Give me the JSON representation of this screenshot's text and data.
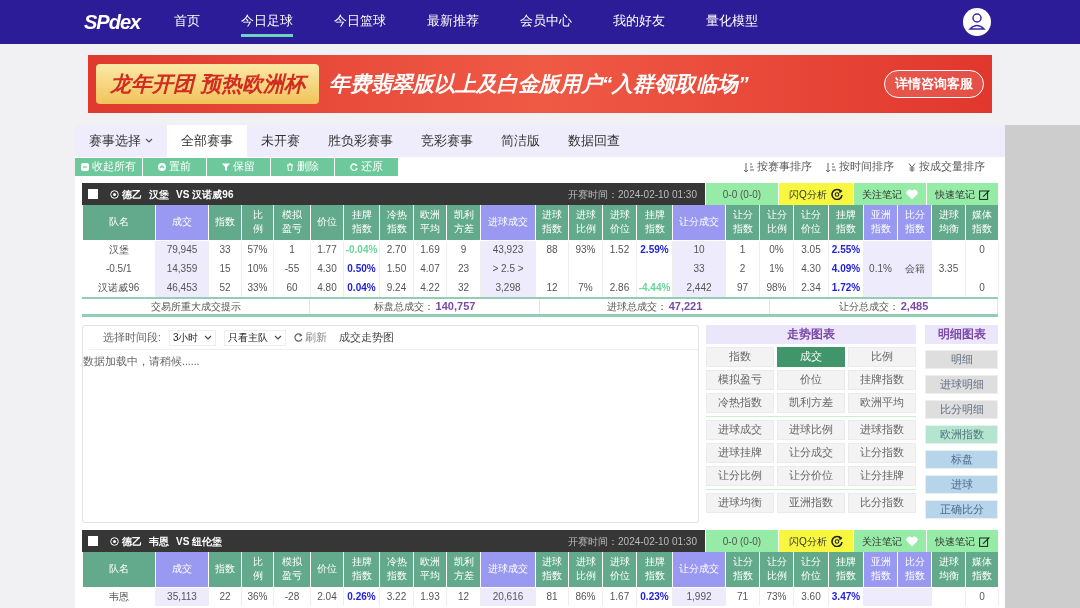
{
  "nav": {
    "logo": "SPdex",
    "items": [
      {
        "label": "首页",
        "selected": false
      },
      {
        "label": "今日足球",
        "selected": true
      },
      {
        "label": "今日篮球",
        "selected": false
      },
      {
        "label": "最新推荐",
        "selected": false
      },
      {
        "label": "会员中心",
        "selected": false
      },
      {
        "label": "我的好友",
        "selected": false
      },
      {
        "label": "量化模型",
        "selected": false
      }
    ]
  },
  "banner": {
    "headline": "龙年开团 预热欧洲杯",
    "message": "年费翡翠版以上及白金版用户“入群领取临场”",
    "button": "详情咨询客服"
  },
  "tabs": [
    {
      "label": "赛事选择",
      "kind": "dropdown",
      "selected": false
    },
    {
      "label": "全部赛事",
      "kind": "tab",
      "selected": true
    },
    {
      "label": "未开赛",
      "kind": "tab",
      "selected": false
    },
    {
      "label": "胜负彩赛事",
      "kind": "tab",
      "selected": false
    },
    {
      "label": "竞彩赛事",
      "kind": "tab",
      "selected": false
    },
    {
      "label": "简洁版",
      "kind": "tab",
      "selected": false
    },
    {
      "label": "数据回查",
      "kind": "tab",
      "selected": false
    }
  ],
  "toolbar": {
    "actions": [
      "收起所有",
      "置前",
      "保留",
      "删除",
      "还原"
    ],
    "sorts": [
      "按赛事排序",
      "按时间排序",
      "按成交量排序"
    ]
  },
  "matches": [
    {
      "checked": false,
      "league": "德乙",
      "home": "汉堡",
      "vs": "VS",
      "away": "汉诺威96",
      "kickoff_label": "开赛时间：",
      "kickoff": "2024-02-10 01:30",
      "score": "0-0 (0-0)",
      "analysis": "闪Q分析",
      "follow": "关注笔记",
      "note": "快速笔记",
      "columns": [
        {
          "label": "队名",
          "highlight": false
        },
        {
          "label": "成交",
          "highlight": true
        },
        {
          "label": "指数",
          "highlight": false
        },
        {
          "label": "比例",
          "highlight": false
        },
        {
          "label": "模拟盈亏",
          "highlight": false
        },
        {
          "label": "价位",
          "highlight": false
        },
        {
          "label": "挂牌指数",
          "highlight": false
        },
        {
          "label": "冷热指数",
          "highlight": false
        },
        {
          "label": "欧洲平均",
          "highlight": false
        },
        {
          "label": "凯利方差",
          "highlight": false
        },
        {
          "label": "进球成交",
          "highlight": true
        },
        {
          "label": "进球指数",
          "highlight": false
        },
        {
          "label": "进球比例",
          "highlight": false
        },
        {
          "label": "进球价位",
          "highlight": false
        },
        {
          "label": "挂牌指数",
          "highlight": false
        },
        {
          "label": "让分成交",
          "highlight": true
        },
        {
          "label": "让分指数",
          "highlight": false
        },
        {
          "label": "让分比例",
          "highlight": false
        },
        {
          "label": "让分价位",
          "highlight": false
        },
        {
          "label": "挂牌指数",
          "highlight": false
        },
        {
          "label": "亚洲指数",
          "highlight": true
        },
        {
          "label": "比分指数",
          "highlight": true
        },
        {
          "label": "进球均衡",
          "highlight": false
        },
        {
          "label": "媒体指数",
          "highlight": false
        }
      ],
      "rows": [
        [
          "汉堡",
          "79,945",
          "33",
          "57%",
          "1",
          "1.77",
          {
            "text": "-0.04%",
            "color": "#66d69a"
          },
          "2.70",
          "1.69",
          "9",
          "43,923",
          "88",
          "93%",
          "1.52",
          {
            "text": "2.59%",
            "color": "#2222dd"
          },
          "10",
          "1",
          "0%",
          "3.05",
          {
            "text": "2.55%",
            "color": "#2222dd"
          },
          null,
          null,
          null,
          "0"
        ],
        [
          "-0.5/1",
          "14,359",
          "15",
          "10%",
          "-55",
          "4.30",
          {
            "text": "0.50%",
            "color": "#2222dd"
          },
          "1.50",
          "4.07",
          "23",
          "> 2.5 >",
          null,
          null,
          null,
          null,
          "33",
          "2",
          "1%",
          "4.30",
          {
            "text": "4.09%",
            "color": "#2222dd"
          },
          "0.1%",
          "会籍",
          "3.35",
          null
        ],
        [
          "汉诺威96",
          "46,453",
          "52",
          "33%",
          "60",
          "4.80",
          {
            "text": "0.04%",
            "color": "#2222dd"
          },
          "9.24",
          "4.22",
          "32",
          "3,298",
          "12",
          "7%",
          "2.86",
          {
            "text": "-4.44%",
            "color": "#66d69a"
          },
          "2,442",
          "97",
          "98%",
          "2.34",
          {
            "text": "1.72%",
            "color": "#2222dd"
          },
          null,
          null,
          null,
          "0"
        ]
      ],
      "summary": [
        {
          "label": "交易所重大成交提示"
        },
        {
          "label": "标盘总成交：",
          "value": "140,757"
        },
        {
          "label": "进球总成交：",
          "value": "47,221"
        },
        {
          "label": "让分总成交：",
          "value": "2,485"
        }
      ],
      "chart_panel": {
        "range_label": "选择时间段:",
        "range": "3小时",
        "team_filter": "只看主队",
        "refresh": "刷新",
        "title": "成交走势图",
        "status": "数据加载中，请稍候......",
        "trend_title": "走势图表",
        "trend_groups": [
          [
            {
              "label": "指数",
              "selected": false
            },
            {
              "label": "成交",
              "selected": true
            },
            {
              "label": "比例",
              "selected": false
            },
            {
              "label": "模拟盈亏",
              "selected": false
            },
            {
              "label": "价位",
              "selected": false
            },
            {
              "label": "挂牌指数",
              "selected": false
            },
            {
              "label": "冷热指数",
              "selected": false
            },
            {
              "label": "凯利方差",
              "selected": false
            },
            {
              "label": "欧洲平均",
              "selected": false
            }
          ],
          [
            {
              "label": "进球成交",
              "selected": false
            },
            {
              "label": "进球比例",
              "selected": false
            },
            {
              "label": "进球指数",
              "selected": false
            },
            {
              "label": "进球挂牌",
              "selected": false
            },
            {
              "label": "让分成交",
              "selected": false
            },
            {
              "label": "让分指数",
              "selected": false
            },
            {
              "label": "让分比例",
              "selected": false
            },
            {
              "label": "让分价位",
              "selected": false
            },
            {
              "label": "让分挂牌",
              "selected": false
            }
          ],
          [
            {
              "label": "进球均衡",
              "selected": false
            },
            {
              "label": "亚洲指数",
              "selected": false
            },
            {
              "label": "比分指数",
              "selected": false
            }
          ]
        ],
        "detail_title": "明细图表",
        "details": [
          {
            "label": "明细",
            "color": "#dedede"
          },
          {
            "label": "进球明细",
            "color": "#dedede"
          },
          {
            "label": "比分明细",
            "color": "#dedede"
          },
          {
            "label": "欧洲指数",
            "color": "#b4e5cf"
          },
          {
            "label": "标盘",
            "color": "#b6d4ea"
          },
          {
            "label": "进球",
            "color": "#b6d4ea"
          },
          {
            "label": "正确比分",
            "color": "#b6d4ea"
          }
        ]
      }
    },
    {
      "checked": false,
      "league": "德乙",
      "home": "韦恩",
      "vs": "VS",
      "away": "纽伦堡",
      "kickoff_label": "开赛时间：",
      "kickoff": "2024-02-10 01:30",
      "score": "0-0 (0-0)",
      "analysis": "闪Q分析",
      "follow": "关注笔记",
      "note": "快速笔记",
      "columns": [
        {
          "label": "队名",
          "highlight": false
        },
        {
          "label": "成交",
          "highlight": true
        },
        {
          "label": "指数",
          "highlight": false
        },
        {
          "label": "比例",
          "highlight": false
        },
        {
          "label": "模拟盈亏",
          "highlight": false
        },
        {
          "label": "价位",
          "highlight": false
        },
        {
          "label": "挂牌指数",
          "highlight": false
        },
        {
          "label": "冷热指数",
          "highlight": false
        },
        {
          "label": "欧洲平均",
          "highlight": false
        },
        {
          "label": "凯利方差",
          "highlight": false
        },
        {
          "label": "进球成交",
          "highlight": true
        },
        {
          "label": "进球指数",
          "highlight": false
        },
        {
          "label": "进球比例",
          "highlight": false
        },
        {
          "label": "进球价位",
          "highlight": false
        },
        {
          "label": "挂牌指数",
          "highlight": false
        },
        {
          "label": "让分成交",
          "highlight": true
        },
        {
          "label": "让分指数",
          "highlight": false
        },
        {
          "label": "让分比例",
          "highlight": false
        },
        {
          "label": "让分价位",
          "highlight": false
        },
        {
          "label": "挂牌指数",
          "highlight": false
        },
        {
          "label": "亚洲指数",
          "highlight": true
        },
        {
          "label": "比分指数",
          "highlight": true
        },
        {
          "label": "进球均衡",
          "highlight": false
        },
        {
          "label": "媒体指数",
          "highlight": false
        }
      ],
      "rows": [
        [
          "韦恩",
          "35,113",
          "22",
          "36%",
          "-28",
          "2.04",
          {
            "text": "0.26%",
            "color": "#2222dd"
          },
          "3.22",
          "1.93",
          "12",
          "20,616",
          "81",
          "86%",
          "1.67",
          {
            "text": "0.23%",
            "color": "#2222dd"
          },
          "1,992",
          "71",
          "73%",
          "3.60",
          {
            "text": "3.47%",
            "color": "#2222dd"
          },
          null,
          null,
          null,
          "0"
        ]
      ]
    }
  ]
}
